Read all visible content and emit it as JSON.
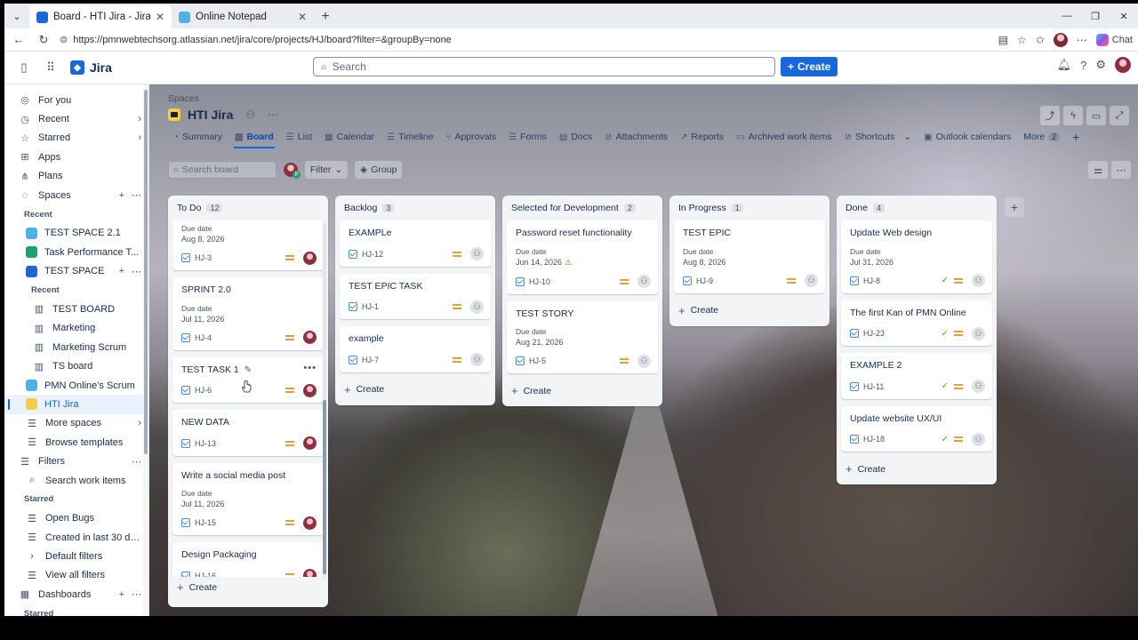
{
  "browser": {
    "tabs": [
      {
        "title": "Board - HTI Jira - Jira",
        "color": "#1868db",
        "active": true
      },
      {
        "title": "Online Notepad",
        "color": "#4bb3e8",
        "active": false
      }
    ],
    "url_prefix": "https://",
    "url": "pmnwebtechsorg.atlassian.net/jira/core/projects/HJ/board?filter=&groupBy=none",
    "chat_label": "Chat"
  },
  "jira": {
    "app_name": "Jira",
    "search_placeholder": "Search",
    "create_label": "Create"
  },
  "sidebar": {
    "top_items": [
      {
        "label": "For you",
        "icon": "for-you-icon"
      },
      {
        "label": "Recent",
        "icon": "clock-icon",
        "chevron": true
      },
      {
        "label": "Starred",
        "icon": "star-icon",
        "chevron": true
      },
      {
        "label": "Apps",
        "icon": "apps-icon"
      },
      {
        "label": "Plans",
        "icon": "plans-icon"
      },
      {
        "label": "Spaces",
        "icon": "spaces-icon"
      }
    ],
    "recent_heading": "Recent",
    "recent_spaces": [
      {
        "label": "TEST SPACE 2.1",
        "color": "#4bb3e8"
      },
      {
        "label": "Task Performance T...",
        "color": "#22a06b"
      },
      {
        "label": "TEST SPACE",
        "color": "#1868db"
      }
    ],
    "nested_heading": "Recent",
    "boards": [
      "TEST BOARD",
      "Marketing",
      "Marketing Scrum",
      "TS board"
    ],
    "more_spaces_items": [
      {
        "label": "PMN Online's Scrum",
        "color": "#4bb3e8"
      },
      {
        "label": "HTI Jira",
        "color": "#f5cd47"
      }
    ],
    "more_spaces": "More spaces",
    "browse_templates": "Browse templates",
    "filters": "Filters",
    "search_work_items": "Search work items",
    "starred_heading": "Starred",
    "starred_filters": [
      "Open Bugs",
      "Created in last 30 da..."
    ],
    "default_filters": "Default filters",
    "view_all_filters": "View all filters",
    "dashboards": "Dashboards",
    "starred_heading_2": "Starred"
  },
  "project": {
    "breadcrumb": "Spaces",
    "name": "HTI Jira",
    "tabs": [
      {
        "label": "Summary",
        "icon": "summary-icon"
      },
      {
        "label": "Board",
        "icon": "board-icon",
        "active": true
      },
      {
        "label": "List",
        "icon": "list-icon"
      },
      {
        "label": "Calendar",
        "icon": "calendar-icon"
      },
      {
        "label": "Timeline",
        "icon": "timeline-icon"
      },
      {
        "label": "Approvals",
        "icon": "approvals-icon"
      },
      {
        "label": "Forms",
        "icon": "forms-icon"
      },
      {
        "label": "Docs",
        "icon": "docs-icon"
      },
      {
        "label": "Attachments",
        "icon": "attachment-icon"
      },
      {
        "label": "Reports",
        "icon": "reports-icon"
      },
      {
        "label": "Archived work items",
        "icon": "archive-icon"
      },
      {
        "label": "Shortcuts",
        "icon": "link-icon"
      },
      {
        "label": "Outlook calendars",
        "icon": "outlook-icon"
      }
    ],
    "more_label": "More",
    "more_count": "2"
  },
  "toolbar": {
    "search_placeholder": "Search board",
    "filter_label": "Filter",
    "group_label": "Group"
  },
  "columns": [
    {
      "name": "To Do",
      "count": "12",
      "cards": [
        {
          "title": "",
          "due_label": "Due date",
          "due": "Aug 8, 2026",
          "key": "HJ-3",
          "assignee": "photo"
        },
        {
          "title": "SPRINT 2.0",
          "due_label": "Due date",
          "due": "Jul 11, 2026",
          "key": "HJ-4",
          "assignee": "photo"
        },
        {
          "title": "TEST TASK 1",
          "key": "HJ-6",
          "assignee": "photo",
          "hover": true
        },
        {
          "title": "NEW DATA",
          "key": "HJ-13",
          "assignee": "photo"
        },
        {
          "title": "Write a social media post",
          "due_label": "Due date",
          "due": "Jul 11, 2026",
          "key": "HJ-15",
          "assignee": "photo"
        },
        {
          "title": "Design Packaging",
          "key": "HJ-16",
          "assignee": "photo"
        }
      ],
      "create": "Create"
    },
    {
      "name": "Backlog",
      "count": "3",
      "cards": [
        {
          "title": "EXAMPLe",
          "key": "HJ-12",
          "assignee": "none"
        },
        {
          "title": "TEST EPIC TASK",
          "key": "HJ-1",
          "assignee": "none"
        },
        {
          "title": "example",
          "key": "HJ-7",
          "assignee": "none"
        }
      ],
      "create": "Create"
    },
    {
      "name": "Selected for Development",
      "count": "2",
      "cards": [
        {
          "title": "Password reset functionality",
          "due_label": "Due date",
          "due": "Jun 14, 2026",
          "warn": true,
          "key": "HJ-10",
          "assignee": "none"
        },
        {
          "title": "TEST STORY",
          "due_label": "Due date",
          "due": "Aug 21, 2026",
          "key": "HJ-5",
          "assignee": "none"
        }
      ],
      "create": "Create"
    },
    {
      "name": "In Progress",
      "count": "1",
      "cards": [
        {
          "title": "TEST EPIC",
          "due_label": "Due date",
          "due": "Aug 8, 2026",
          "key": "HJ-9",
          "assignee": "none"
        }
      ],
      "create": "Create"
    },
    {
      "name": "Done",
      "count": "4",
      "cards": [
        {
          "title": "Update Web design",
          "due_label": "Due date",
          "due": "Jul 31, 2026",
          "key": "HJ-8",
          "assignee": "none",
          "done": true
        },
        {
          "title": "The first Kan of PMN Online",
          "key": "HJ-23",
          "assignee": "none",
          "done": true
        },
        {
          "title": "EXAMPLE 2",
          "key": "HJ-11",
          "assignee": "none",
          "done": true
        },
        {
          "title": "Update website UX/UI",
          "key": "HJ-18",
          "assignee": "none",
          "done": true
        }
      ],
      "create": "Create"
    }
  ]
}
